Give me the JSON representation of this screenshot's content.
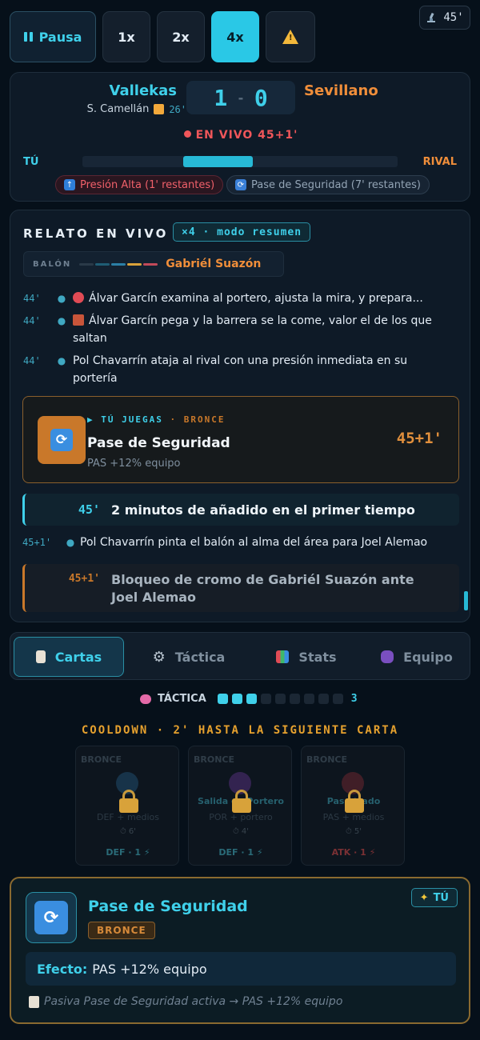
{
  "controls": {
    "pause_label": "Pausa",
    "speeds": [
      "1x",
      "2x",
      "4x"
    ],
    "active_speed": "4x",
    "warn_icon": "warning-icon"
  },
  "clock": {
    "icon": "microscope-icon",
    "value": "45'"
  },
  "scoreboard": {
    "home": "Vallekas",
    "away": "Sevillano",
    "home_score": "1",
    "away_score": "0",
    "separator": "-",
    "scorer": "S. Camellán",
    "scorer_minute": "26'",
    "live": "EN VIVO 45+1'",
    "you_label": "TÚ",
    "rival_label": "RIVAL",
    "possession_fraction": 0.22,
    "pill_pressure": "Presión Alta (1' restantes)",
    "pill_pass": "Pase de Seguridad (7' restantes)"
  },
  "relato": {
    "title": "RELATO EN VIVO",
    "mode": "×4 · modo resumen",
    "ball_label": "BALÓN",
    "ball_holder": "Gabriél Suazón",
    "events": [
      {
        "t": "44'",
        "text": "Álvar Garcín examina al portero, ajusta la mira, y prepara..."
      },
      {
        "t": "44'",
        "text": "Álvar Garcín pega y la barrera se la come, valor el de los que saltan"
      },
      {
        "t": "44'",
        "text": "Pol Chavarrín ataja al rival con una presión inmediata en su portería"
      }
    ],
    "card_event": {
      "you_play": "TÚ JUEGAS",
      "tier": "· BRONCE",
      "name": "Pase de Seguridad",
      "effect": "PAS +12% equipo",
      "minute": "45+1'"
    },
    "added_time": {
      "t": "45'",
      "text": "2 minutos de añadido en el primer tiempo"
    },
    "event_after": {
      "t": "45+1'",
      "text": "Pol Chavarrín pinta el balón al alma del área para Joel Alemao"
    },
    "block": {
      "t": "45+1'",
      "text": "Bloqueo de cromo de Gabriél Suazón ante Joel Alemao"
    }
  },
  "tabs": [
    {
      "label": "Cartas",
      "icon": "cards-icon"
    },
    {
      "label": "Táctica",
      "icon": "gear-icon"
    },
    {
      "label": "Stats",
      "icon": "chart-icon"
    },
    {
      "label": "Equipo",
      "icon": "team-icon"
    }
  ],
  "tactic": {
    "label": "TÁCTICA",
    "filled": 3,
    "total": 9,
    "value": "3"
  },
  "cooldown": "COOLDOWN · 2' HASTA LA SIGUIENTE CARTA",
  "mini_cards": [
    {
      "tier": "BRONCE",
      "icon": "anchor-icon",
      "name": "",
      "effect": "DEF +  medios",
      "cd": "⏱ 6'",
      "cost": "DEF · 1 ⚡",
      "cost_color": "#2a6b78"
    },
    {
      "tier": "BRONCE",
      "icon": "glove-icon",
      "name": "Salida de Portero",
      "effect": "POR +  portero",
      "cd": "⏱ 4'",
      "cost": "DEF · 1 ⚡",
      "cost_color": "#2a6b78"
    },
    {
      "tier": "BRONCE",
      "icon": "target-icon",
      "name": "Pase  trado",
      "effect": "PAS +  medios",
      "cd": "⏱ 5'",
      "cost": "ATK · 1 ⚡",
      "cost_color": "#7a3034"
    }
  ],
  "selected": {
    "name": "Pase de Seguridad",
    "tier": "BRONCE",
    "you": "TÚ",
    "effect_label": "Efecto:",
    "effect": "PAS +12% equipo",
    "note": "Pasiva Pase de Seguridad activa → PAS +12% equipo"
  }
}
